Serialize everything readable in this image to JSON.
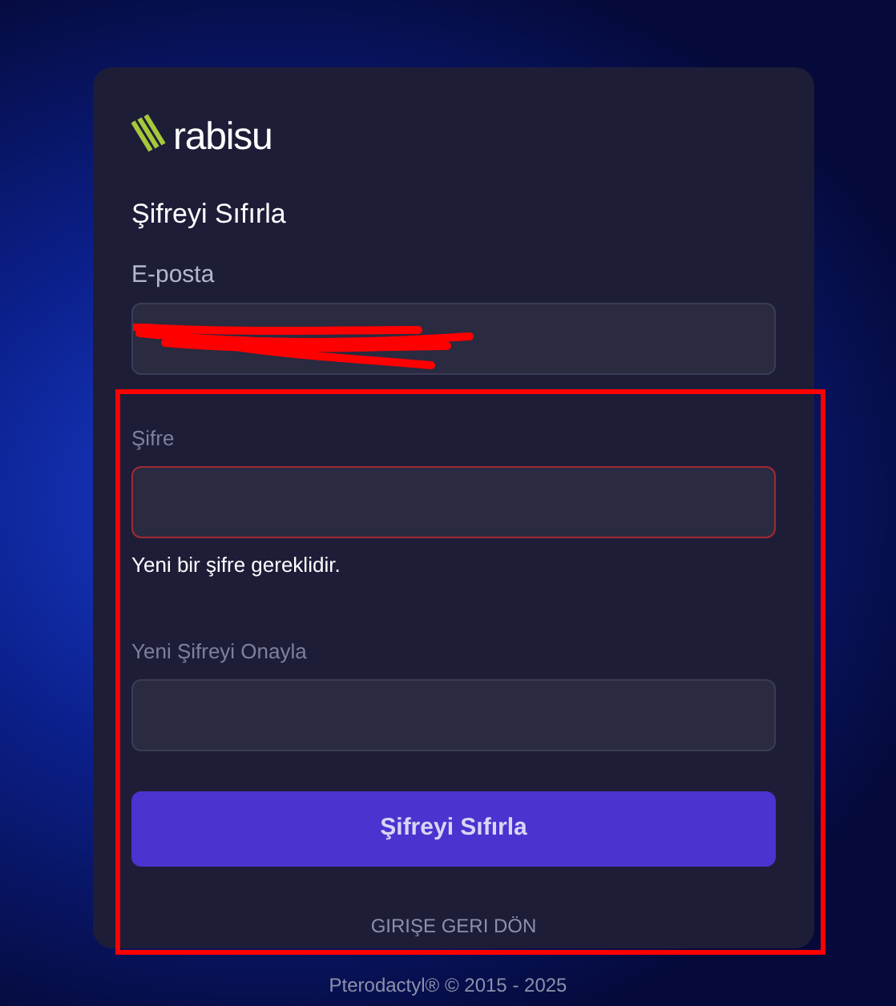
{
  "logo": {
    "text": "rabisu"
  },
  "title": "Şifreyi Sıfırla",
  "fields": [
    {
      "kind": "email",
      "label": "E-posta",
      "redacted": true,
      "error": false
    },
    {
      "kind": "password",
      "label": "Şifre",
      "redacted": false,
      "error": true,
      "error_text": "Yeni bir şifre gereklidir."
    },
    {
      "kind": "password",
      "label": "Yeni Şifreyi Onayla",
      "redacted": false,
      "error": false
    }
  ],
  "submit_button": "Şifreyi Sıfırla",
  "back_link": "GIRIŞE GERI DÖN",
  "footer": "Pterodactyl® © 2015 - 2025",
  "highlight": true
}
